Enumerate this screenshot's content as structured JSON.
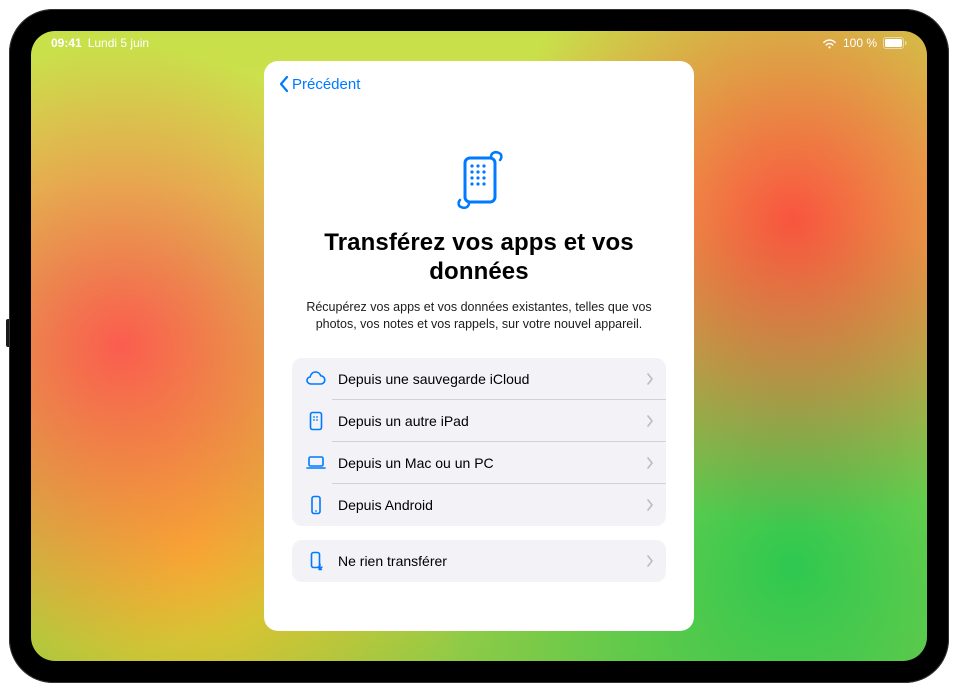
{
  "status_bar": {
    "time": "09:41",
    "date": "Lundi 5 juin",
    "battery_text": "100 %"
  },
  "modal": {
    "back_label": "Précédent",
    "title": "Transférez vos apps et vos données",
    "subtitle": "Récupérez vos apps et vos données existantes, telles que vos photos, vos notes et vos rappels, sur votre nouvel appareil.",
    "options_primary": [
      {
        "icon": "cloud-icon",
        "label": "Depuis une sauvegarde iCloud"
      },
      {
        "icon": "ipad-icon",
        "label": "Depuis un autre iPad"
      },
      {
        "icon": "laptop-icon",
        "label": "Depuis un Mac ou un PC"
      },
      {
        "icon": "phone-icon",
        "label": "Depuis Android"
      }
    ],
    "options_secondary": [
      {
        "icon": "phone-skip-icon",
        "label": "Ne rien transférer"
      }
    ]
  },
  "colors": {
    "accent": "#007aff",
    "group_bg": "#f2f2f7"
  }
}
